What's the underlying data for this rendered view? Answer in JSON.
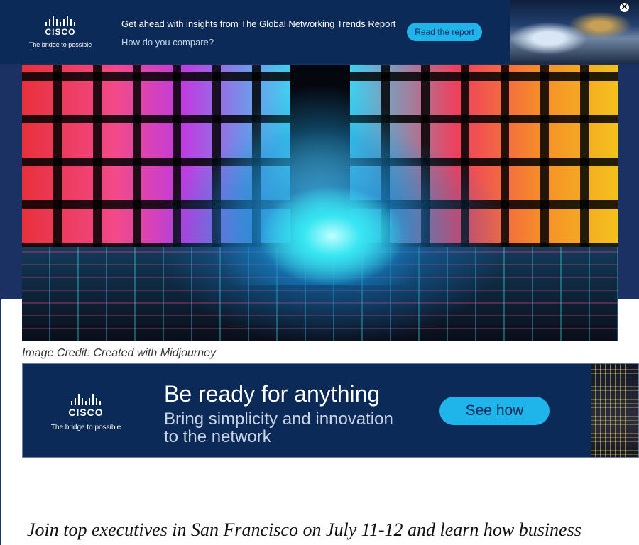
{
  "top_ad": {
    "brand": "CISCO",
    "tagline": "The bridge to possible",
    "headline": "Get ahead with insights from The Global Networking Trends Report",
    "subheadline": "How do you compare?",
    "cta_label": "Read the report",
    "close_icon": "close-icon",
    "close_glyph": "✕"
  },
  "article": {
    "image_credit": "Image Credit: Created with Midjourney",
    "lead_text": "Join top executives in San Francisco on July 11-12 and learn how business"
  },
  "mid_ad": {
    "brand": "CISCO",
    "tagline": "The bridge to possible",
    "headline": "Be ready for anything",
    "sub_line1": "Bring simplicity and innovation",
    "sub_line2": "to the network",
    "cta_label": "See how"
  },
  "colors": {
    "ad_bg": "#0c2a57",
    "accent": "#1fb4ea",
    "header_band": "#1c3163"
  }
}
